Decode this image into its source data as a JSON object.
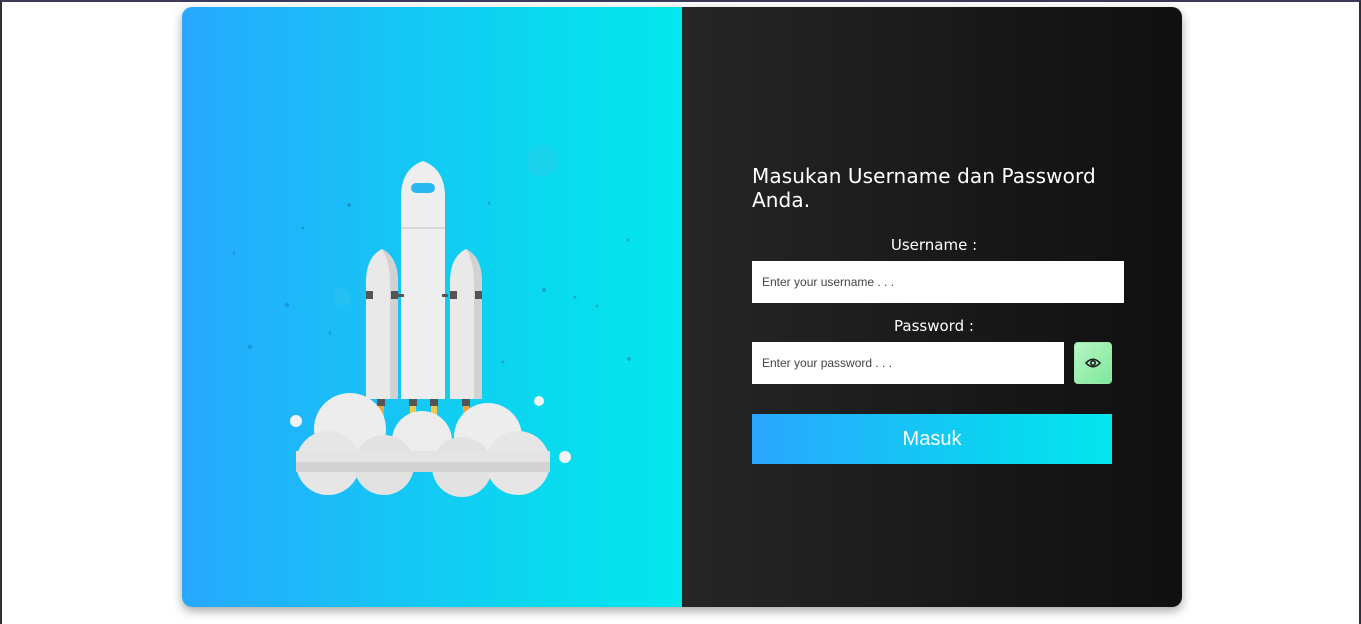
{
  "login": {
    "title": "Masukan Username dan Password Anda.",
    "username_label": "Username :",
    "username_placeholder": "Enter your username . . .",
    "username_value": "",
    "password_label": "Password :",
    "password_placeholder": "Enter your password . . .",
    "password_value": "",
    "toggle_password_icon": "eye-icon",
    "submit_label": "Masuk"
  },
  "illustration": {
    "icon": "rocket-launch-illustration"
  },
  "colors": {
    "left_gradient_start": "#27a8ff",
    "left_gradient_end": "#03e8ee",
    "right_panel": "#1c1c1c",
    "button_gradient_start": "#2aa6ff",
    "button_gradient_end": "#04e6ee",
    "eye_button": "#a6f0b6"
  }
}
